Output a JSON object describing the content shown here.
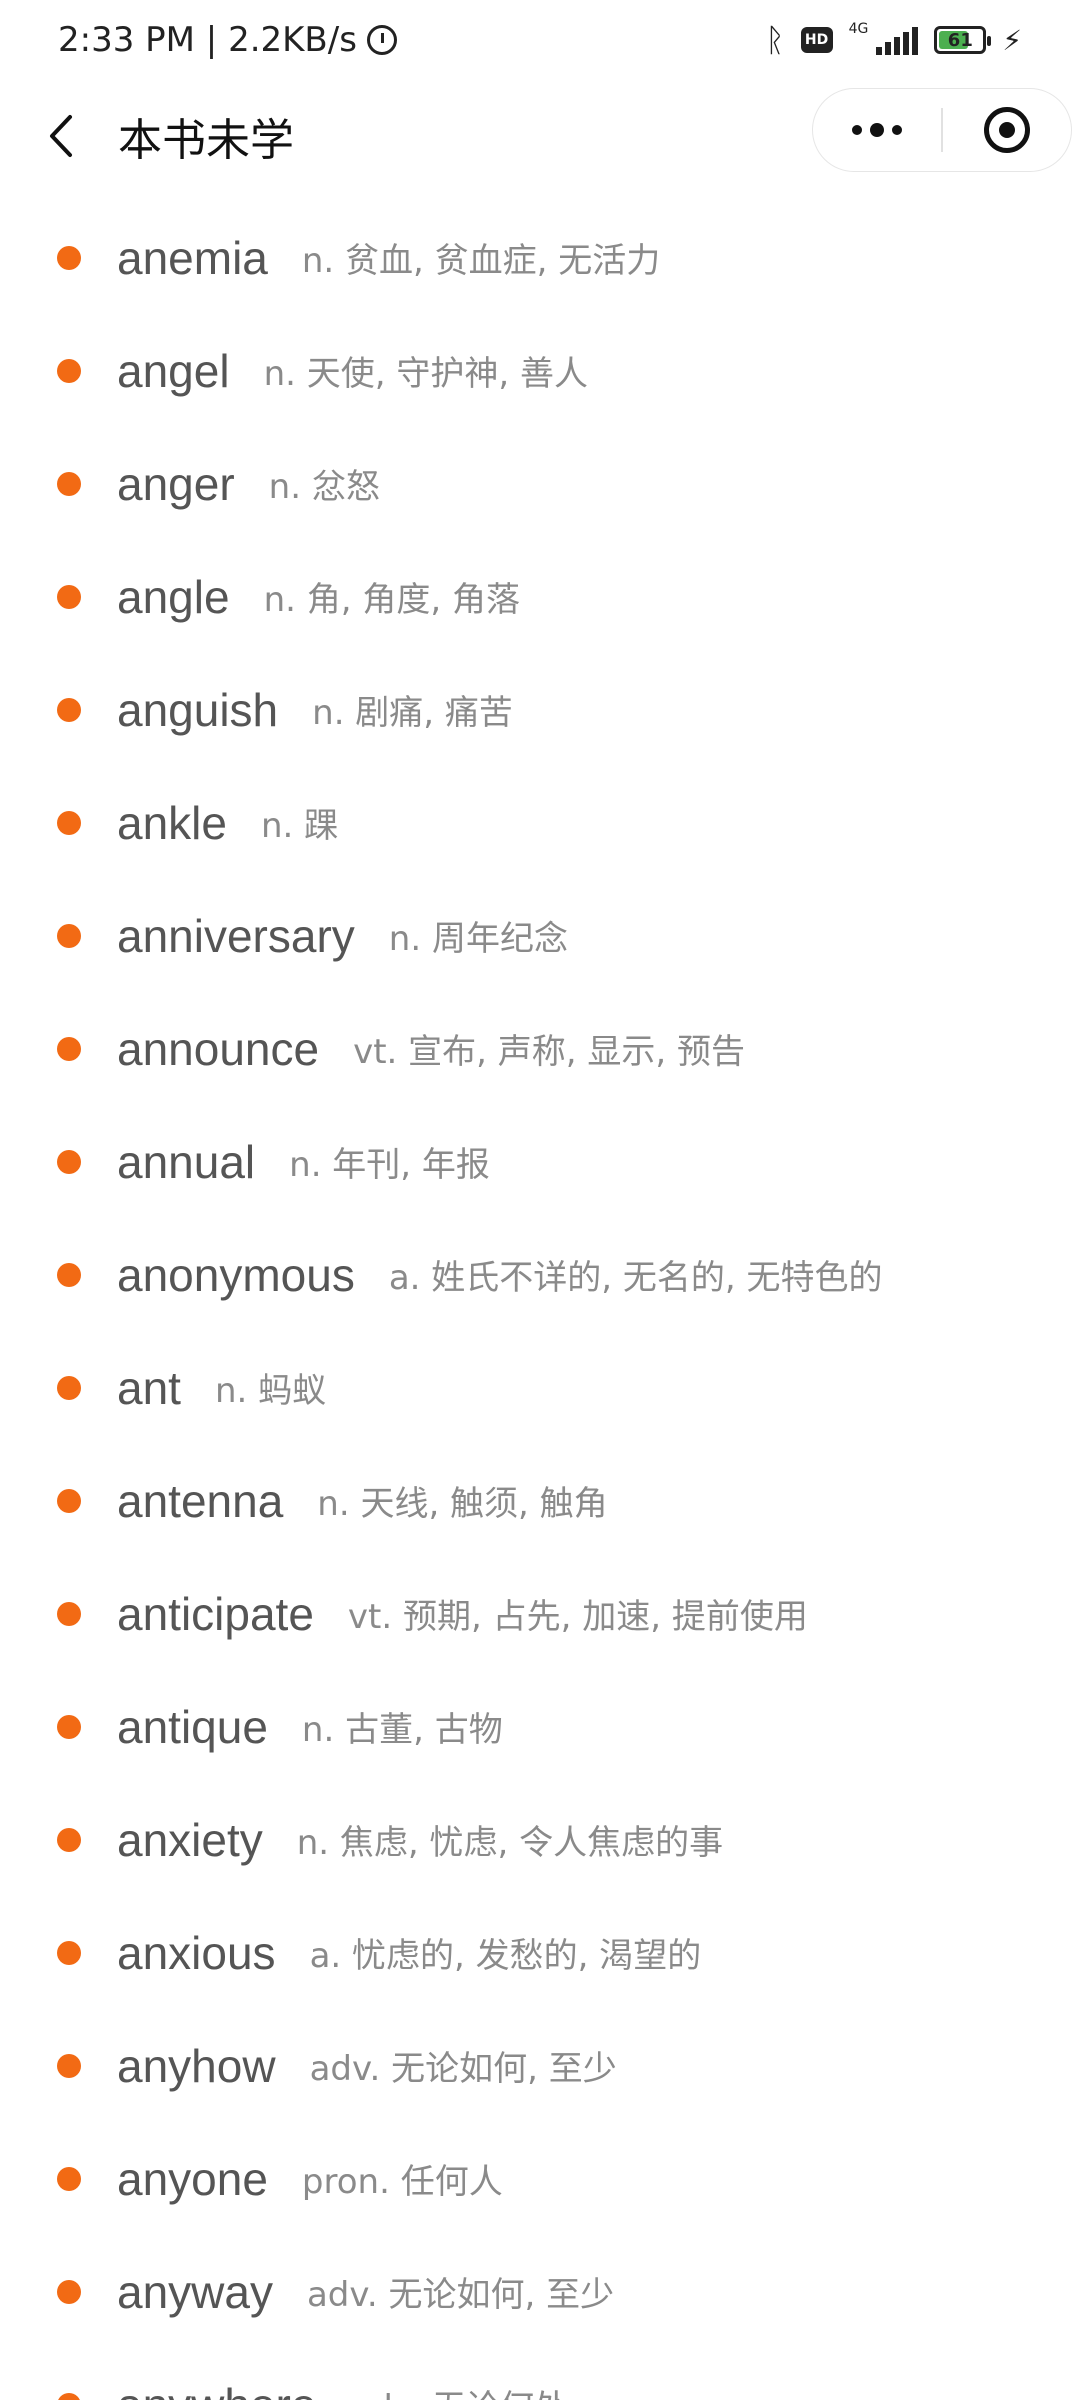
{
  "status_bar": {
    "time_speed": "2:33 PM | 2.2KB/s",
    "hd_label": "HD",
    "net_label": "4G",
    "battery_level": "61"
  },
  "header": {
    "title": "本书未学"
  },
  "words": [
    {
      "word": "anemia",
      "def": "n. 贫血, 贫血症, 无活力"
    },
    {
      "word": "angel",
      "def": "n. 天使, 守护神, 善人"
    },
    {
      "word": "anger",
      "def": "n. 忿怒"
    },
    {
      "word": "angle",
      "def": "n. 角, 角度, 角落"
    },
    {
      "word": "anguish",
      "def": "n. 剧痛, 痛苦"
    },
    {
      "word": "ankle",
      "def": "n. 踝"
    },
    {
      "word": "anniversary",
      "def": "n. 周年纪念"
    },
    {
      "word": "announce",
      "def": "vt. 宣布, 声称, 显示, 预告"
    },
    {
      "word": "annual",
      "def": "n. 年刊, 年报"
    },
    {
      "word": "anonymous",
      "def": "a. 姓氏不详的, 无名的, 无特色的"
    },
    {
      "word": "ant",
      "def": "n. 蚂蚁"
    },
    {
      "word": "antenna",
      "def": "n. 天线, 触须, 触角"
    },
    {
      "word": "anticipate",
      "def": "vt. 预期, 占先, 加速, 提前使用"
    },
    {
      "word": "antique",
      "def": "n. 古董, 古物"
    },
    {
      "word": "anxiety",
      "def": "n. 焦虑, 忧虑, 令人焦虑的事"
    },
    {
      "word": "anxious",
      "def": "a. 忧虑的, 发愁的, 渴望的"
    },
    {
      "word": "anyhow",
      "def": "adv. 无论如何, 至少"
    },
    {
      "word": "anyone",
      "def": "pron. 任何人"
    },
    {
      "word": "anyway",
      "def": "adv. 无论如何, 至少"
    },
    {
      "word": "anywhere",
      "def": "adv. 无论何处"
    }
  ],
  "colors": {
    "bullet": "#f26a14",
    "word_text": "#555555",
    "definition_text": "#8a8a8a"
  }
}
